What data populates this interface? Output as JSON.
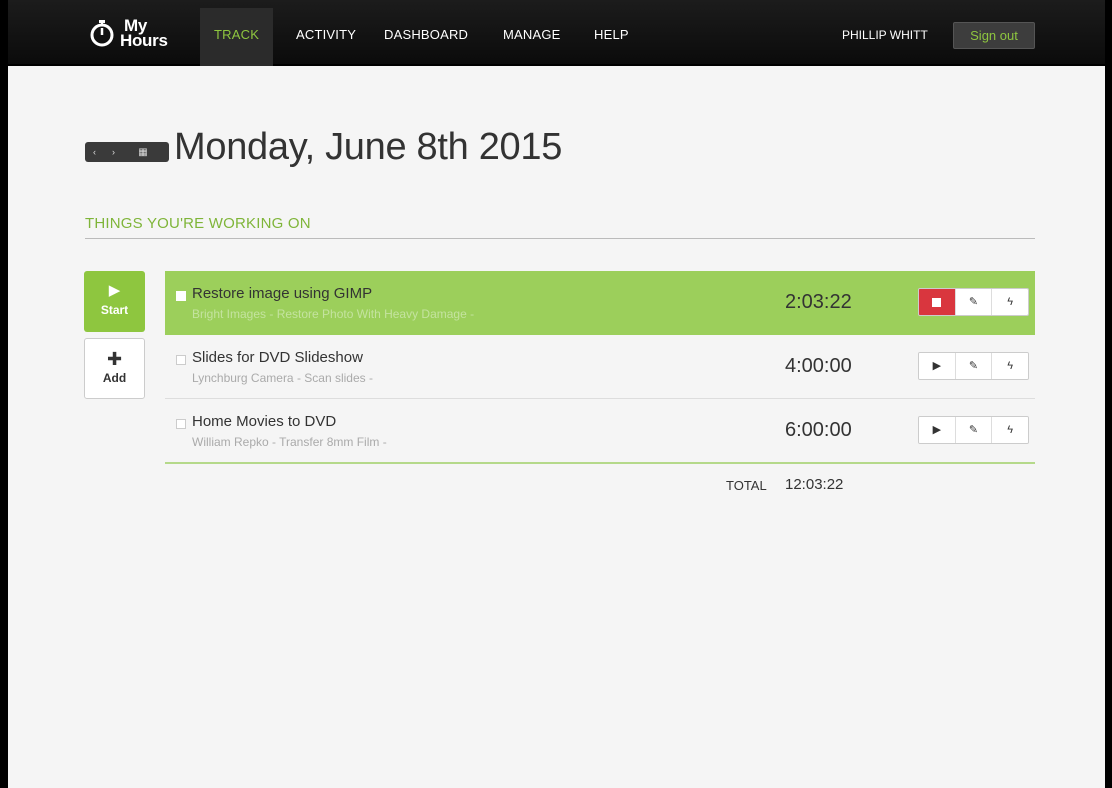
{
  "app": {
    "logo_top": "My",
    "logo_bottom": "Hours"
  },
  "nav": {
    "items": [
      {
        "label": "TRACK",
        "active": true
      },
      {
        "label": "ACTIVITY",
        "active": false
      },
      {
        "label": "DASHBOARD",
        "active": false
      },
      {
        "label": "MANAGE",
        "active": false
      },
      {
        "label": "HELP",
        "active": false
      }
    ],
    "user_name": "PHILLIP WHITT",
    "signout_label": "Sign out"
  },
  "date": {
    "title": "Monday, June 8th 2015",
    "prev_icon": "‹",
    "next_icon": "›",
    "calendar_icon": "▦"
  },
  "section": {
    "title": "THINGS YOU'RE WORKING ON"
  },
  "actions": {
    "start_label": "Start",
    "add_label": "Add"
  },
  "tasks": [
    {
      "title": "Restore image using GIMP",
      "subtitle": "Bright Images - Restore Photo With Heavy Damage -",
      "time": "2:03:22",
      "running": true
    },
    {
      "title": "Slides for DVD Slideshow",
      "subtitle": "Lynchburg Camera - Scan slides -",
      "time": "4:00:00",
      "running": false
    },
    {
      "title": "Home Movies to DVD",
      "subtitle": "William Repko - Transfer 8mm Film -",
      "time": "6:00:00",
      "running": false
    }
  ],
  "total": {
    "label": "TOTAL",
    "value": "12:03:22"
  },
  "colors": {
    "accent": "#8ec63f",
    "active_row": "#9ccf5b",
    "stop": "#d9363e",
    "navbar": "#111111"
  }
}
